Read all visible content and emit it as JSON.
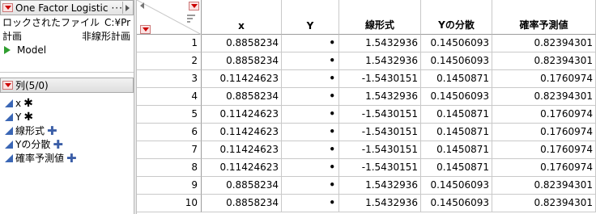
{
  "table_panel": {
    "title": "One Factor Logistic",
    "more": "···",
    "locked_file": "ロックされたファイル",
    "locked_path": "C:¥Pr",
    "notes_label": "計画",
    "notes_value": "非線形計画",
    "script_label": "Model"
  },
  "columns_panel": {
    "title": "列(5/0)",
    "items": [
      {
        "label": "x",
        "marker": "✱"
      },
      {
        "label": "Y",
        "marker": "✱"
      },
      {
        "label": "線形式",
        "marker": "✚"
      },
      {
        "label": "Yの分散",
        "marker": "✚"
      },
      {
        "label": "確率予測値",
        "marker": "✚"
      }
    ]
  },
  "grid": {
    "headers": [
      "x",
      "Y",
      "線形式",
      "Yの分散",
      "確率予測値"
    ],
    "rows": [
      {
        "n": "1",
        "x": "0.8858234",
        "y": "•",
        "lin": "1.5432936",
        "var": "0.14506093",
        "prob": "0.82394301"
      },
      {
        "n": "2",
        "x": "0.8858234",
        "y": "•",
        "lin": "1.5432936",
        "var": "0.14506093",
        "prob": "0.82394301"
      },
      {
        "n": "3",
        "x": "0.11424623",
        "y": "•",
        "lin": "-1.5430151",
        "var": "0.1450871",
        "prob": "0.1760974"
      },
      {
        "n": "4",
        "x": "0.8858234",
        "y": "•",
        "lin": "1.5432936",
        "var": "0.14506093",
        "prob": "0.82394301"
      },
      {
        "n": "5",
        "x": "0.11424623",
        "y": "•",
        "lin": "-1.5430151",
        "var": "0.1450871",
        "prob": "0.1760974"
      },
      {
        "n": "6",
        "x": "0.11424623",
        "y": "•",
        "lin": "-1.5430151",
        "var": "0.1450871",
        "prob": "0.1760974"
      },
      {
        "n": "7",
        "x": "0.11424623",
        "y": "•",
        "lin": "-1.5430151",
        "var": "0.1450871",
        "prob": "0.1760974"
      },
      {
        "n": "8",
        "x": "0.11424623",
        "y": "•",
        "lin": "-1.5430151",
        "var": "0.1450871",
        "prob": "0.1760974"
      },
      {
        "n": "9",
        "x": "0.8858234",
        "y": "•",
        "lin": "1.5432936",
        "var": "0.14506093",
        "prob": "0.82394301"
      },
      {
        "n": "10",
        "x": "0.8858234",
        "y": "•",
        "lin": "1.5432936",
        "var": "0.14506093",
        "prob": "0.82394301"
      }
    ]
  },
  "colors": {
    "accent_red": "#cc0000",
    "column_icon_blue": "#3a66b5",
    "script_green": "#2f9e2f"
  }
}
